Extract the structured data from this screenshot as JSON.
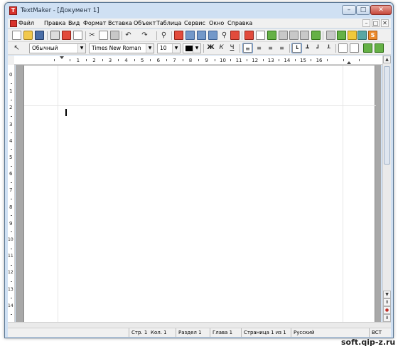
{
  "window": {
    "title": "TextMaker - [Документ 1]",
    "app_icon_letter": "T",
    "min_glyph": "–",
    "max_glyph": "□",
    "close_glyph": "✕"
  },
  "menu": {
    "items": [
      "Файл",
      "Правка",
      "Вид",
      "Формат",
      "Вставка",
      "Объект",
      "Таблица",
      "Сервис",
      "Окно",
      "Справка"
    ],
    "mdi": [
      "–",
      "□",
      "✕"
    ]
  },
  "toolbar": {
    "style": "Обычный",
    "font": "Times New Roman",
    "size": "10",
    "dropdown_arrow": "▼",
    "bold": "Ж",
    "italic": "К",
    "underline": "Ч",
    "badge_s": "S"
  },
  "ruler": {
    "h_numbers": [
      "1",
      "2",
      "3",
      "4",
      "5",
      "6",
      "7",
      "8",
      "9",
      "10",
      "11",
      "12",
      "13",
      "14",
      "15",
      "16"
    ],
    "v_numbers": [
      "0",
      "1",
      "2",
      "3",
      "4",
      "5",
      "6",
      "7",
      "8",
      "9",
      "10",
      "11",
      "12",
      "13",
      "14"
    ]
  },
  "status": {
    "line": "Стр. 1",
    "col": "Кол. 1",
    "section": "Раздел 1",
    "chapter": "Глава 1",
    "page": "Страница 1 из 1",
    "lang": "Русский",
    "mode": "ВСТ"
  },
  "scroll": {
    "up": "▲",
    "down": "▼",
    "prev": "⬆",
    "dot": "●",
    "next": "⬇"
  },
  "watermark": "soft.qip-z.ru"
}
